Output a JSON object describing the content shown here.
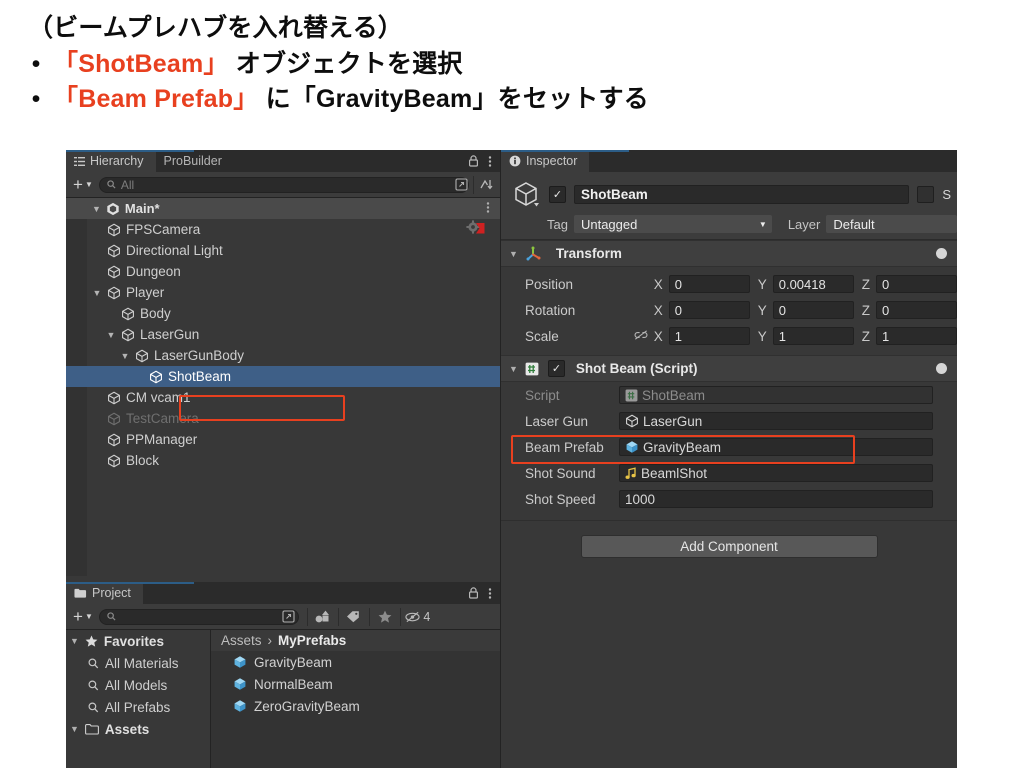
{
  "slide": {
    "title": "（ビームプレハブを入れ替える）",
    "bullets": [
      {
        "dot": "•",
        "parts": [
          {
            "t": "「ShotBeam」",
            "c": "red"
          },
          {
            "t": " オブジェクトを選択",
            "c": "blk"
          }
        ]
      },
      {
        "dot": "•",
        "parts": [
          {
            "t": "「Beam Prefab」",
            "c": "red"
          },
          {
            "t": " に「GravityBeam」をセットする",
            "c": "blk"
          }
        ]
      }
    ]
  },
  "hierarchy": {
    "tabs": [
      {
        "label": "Hierarchy",
        "icon": "hierarchy-icon",
        "active": true
      },
      {
        "label": "ProBuilder",
        "icon": "",
        "active": false
      }
    ],
    "lock_icon": "lock-icon",
    "menu_icon": "kebab-menu-icon",
    "toolbar": {
      "add_label": "+",
      "search_placeholder": "All",
      "search_value": "",
      "search_icon": "search-icon",
      "expand_icon": "open-in-new-icon",
      "sort_icon": "sort-icon"
    },
    "scene": {
      "label": "Main*",
      "icon": "unity-scene-icon"
    },
    "items": [
      {
        "label": "FPSCamera",
        "depth": 2,
        "arrow": "",
        "dim": false,
        "badge": "gear-arrow-icon"
      },
      {
        "label": "Directional Light",
        "depth": 2,
        "arrow": "",
        "dim": false,
        "badge": ""
      },
      {
        "label": "Dungeon",
        "depth": 2,
        "arrow": "",
        "dim": false,
        "badge": ""
      },
      {
        "label": "Player",
        "depth": 2,
        "arrow": "▼",
        "dim": false,
        "badge": ""
      },
      {
        "label": "Body",
        "depth": 3,
        "arrow": "",
        "dim": false,
        "badge": ""
      },
      {
        "label": "LaserGun",
        "depth": 3,
        "arrow": "▼",
        "dim": false,
        "badge": ""
      },
      {
        "label": "LaserGunBody",
        "depth": 4,
        "arrow": "▼",
        "dim": false,
        "badge": ""
      },
      {
        "label": "ShotBeam",
        "depth": 5,
        "arrow": "",
        "dim": false,
        "badge": "",
        "selected": true
      },
      {
        "label": "CM vcam1",
        "depth": 2,
        "arrow": "",
        "dim": false,
        "badge": ""
      },
      {
        "label": "TestCamera",
        "depth": 2,
        "arrow": "",
        "dim": true,
        "badge": ""
      },
      {
        "label": "PPManager",
        "depth": 2,
        "arrow": "",
        "dim": false,
        "badge": ""
      },
      {
        "label": "Block",
        "depth": 2,
        "arrow": "",
        "dim": false,
        "badge": ""
      }
    ]
  },
  "project": {
    "tab": {
      "label": "Project",
      "icon": "folder-icon"
    },
    "lock_icon": "lock-icon",
    "menu_icon": "kebab-menu-icon",
    "toolbar": {
      "add_label": "+",
      "search_placeholder": "",
      "search_value": "",
      "search_icon": "search-icon",
      "expand_icon": "open-in-new-icon",
      "shapes_icon": "shape-filter-icon",
      "tag_icon": "tag-icon",
      "star_icon": "star-icon",
      "hidden_icon": "hidden-eye-icon",
      "hidden_count": "4"
    },
    "sidebar": [
      {
        "label": "Favorites",
        "type": "root",
        "arrow": "▼",
        "icon": "star-icon"
      },
      {
        "label": "All Materials",
        "type": "child",
        "icon": "search-icon"
      },
      {
        "label": "All Models",
        "type": "child",
        "icon": "search-icon"
      },
      {
        "label": "All Prefabs",
        "type": "child",
        "icon": "search-icon"
      },
      {
        "label": "Assets",
        "type": "root",
        "arrow": "▼",
        "icon": "folder-icon"
      }
    ],
    "breadcrumb": {
      "root": "Assets",
      "sep": "›",
      "current": "MyPrefabs"
    },
    "assets": [
      {
        "label": "GravityBeam",
        "icon": "prefab-cube-icon"
      },
      {
        "label": "NormalBeam",
        "icon": "prefab-cube-icon"
      },
      {
        "label": "ZeroGravityBeam",
        "icon": "prefab-cube-icon"
      }
    ]
  },
  "inspector": {
    "tab": {
      "label": "Inspector",
      "icon": "info-icon"
    },
    "object": {
      "enabled": true,
      "name": "ShotBeam",
      "icon": "gameobject-cube-icon",
      "static_label": "S",
      "tag_label": "Tag",
      "tag_value": "Untagged",
      "layer_label": "Layer",
      "layer_value": "Default"
    },
    "transform": {
      "title": "Transform",
      "icon": "transform-gizmo-icon",
      "fold": "▼",
      "rows": [
        {
          "label": "Position",
          "x": "0",
          "y": "0.00418",
          "z": "0",
          "link": false
        },
        {
          "label": "Rotation",
          "x": "0",
          "y": "0",
          "z": "0",
          "link": false
        },
        {
          "label": "Scale",
          "x": "1",
          "y": "1",
          "z": "1",
          "link": true,
          "link_icon": "broken-link-icon"
        }
      ],
      "axes": [
        "X",
        "Y",
        "Z"
      ]
    },
    "script_component": {
      "title": "Shot Beam (Script)",
      "icon": "cs-script-icon",
      "fold": "▼",
      "enabled": true,
      "fields": [
        {
          "label": "Script",
          "value": "ShotBeam",
          "icon": "cs-script-icon",
          "disabled": true
        },
        {
          "label": "Laser Gun",
          "value": "LaserGun",
          "icon": "gameobject-cube-icon",
          "disabled": false
        },
        {
          "label": "Beam Prefab",
          "value": "GravityBeam",
          "icon": "prefab-cube-icon",
          "disabled": false,
          "highlight": true
        },
        {
          "label": "Shot Sound",
          "value": "BeamlShot",
          "icon": "audio-note-icon",
          "disabled": false
        },
        {
          "label": "Shot Speed",
          "value": "1000",
          "icon": "",
          "disabled": false
        }
      ]
    },
    "add_component_label": "Add Component"
  },
  "colors": {
    "accent_red": "#e8401f",
    "selection_blue": "#3e5f87",
    "panel_bg": "#383838",
    "tab_bg": "#2b2b2b",
    "prefab_blue": "#63b8e8",
    "audio_yellow": "#e8c447"
  }
}
